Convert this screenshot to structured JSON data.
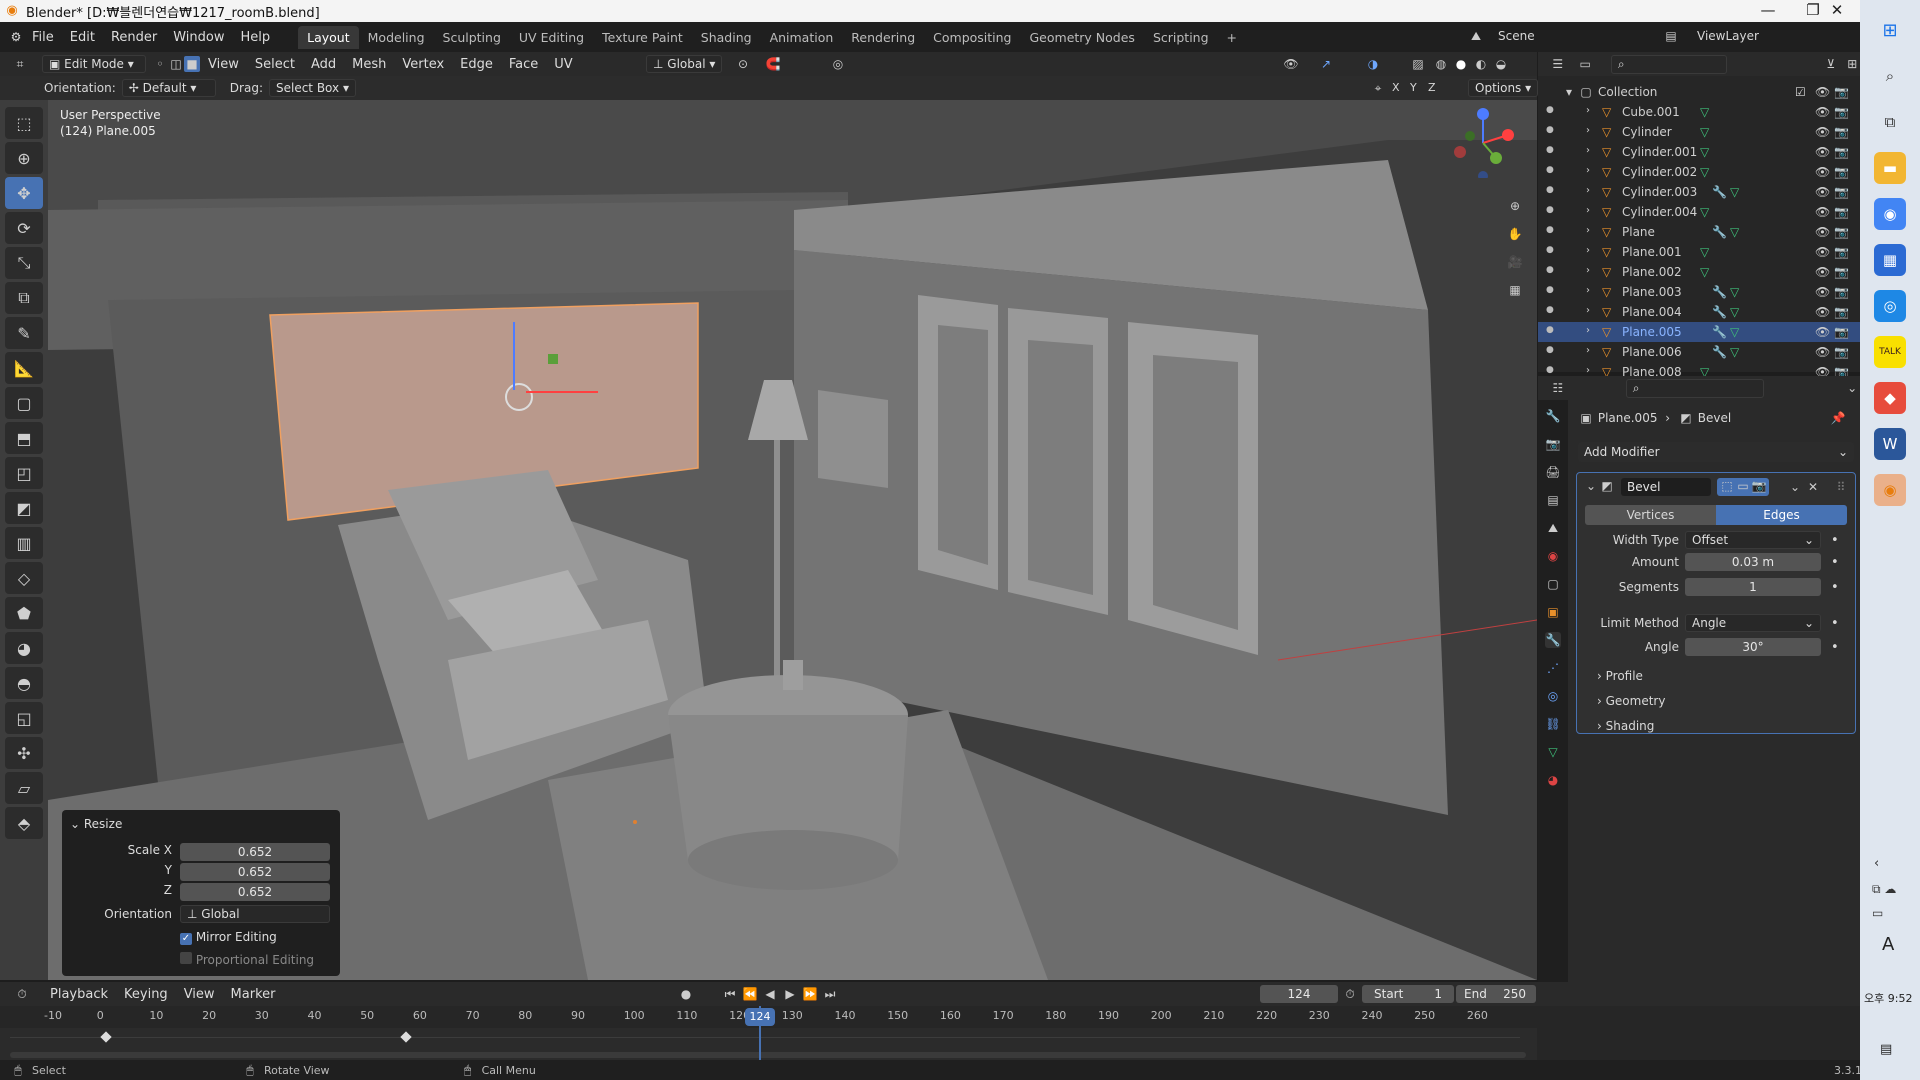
{
  "window": {
    "title": "Blender* [D:₩블렌더연습₩1217_roomB.blend]"
  },
  "menu": {
    "file": "File",
    "edit": "Edit",
    "render": "Render",
    "window": "Window",
    "help": "Help"
  },
  "workspaces": [
    "Layout",
    "Modeling",
    "Sculpting",
    "UV Editing",
    "Texture Paint",
    "Shading",
    "Animation",
    "Rendering",
    "Compositing",
    "Geometry Nodes",
    "Scripting"
  ],
  "scene": {
    "label": "Scene",
    "view_layer": "ViewLayer"
  },
  "header": {
    "mode": "Edit Mode",
    "menus": [
      "View",
      "Select",
      "Add",
      "Mesh",
      "Vertex",
      "Edge",
      "Face",
      "UV"
    ],
    "transform": "Global",
    "orientation_label": "Orientation:",
    "orientation_value": "Default",
    "drag_label": "Drag:",
    "drag_value": "Select Box",
    "axes": [
      "X",
      "Y",
      "Z"
    ],
    "options": "Options"
  },
  "viewport": {
    "perspective": "User Perspective",
    "object": "(124) Plane.005"
  },
  "operator": {
    "title": "Resize",
    "scale_x_label": "Scale X",
    "scale_x": "0.652",
    "y_label": "Y",
    "y": "0.652",
    "z_label": "Z",
    "z": "0.652",
    "orientation_label": "Orientation",
    "orientation": "Global",
    "mirror": "Mirror Editing",
    "mirror_checked": true,
    "proportional": "Proportional Editing",
    "proportional_checked": false
  },
  "outliner": {
    "collection": "Collection",
    "items": [
      {
        "name": "Cube.001",
        "mod": false
      },
      {
        "name": "Cylinder",
        "mod": false
      },
      {
        "name": "Cylinder.001",
        "mod": false
      },
      {
        "name": "Cylinder.002",
        "mod": false
      },
      {
        "name": "Cylinder.003",
        "mod": true
      },
      {
        "name": "Cylinder.004",
        "mod": false
      },
      {
        "name": "Plane",
        "mod": true
      },
      {
        "name": "Plane.001",
        "mod": false
      },
      {
        "name": "Plane.002",
        "mod": false
      },
      {
        "name": "Plane.003",
        "mod": true
      },
      {
        "name": "Plane.004",
        "mod": true
      },
      {
        "name": "Plane.005",
        "mod": true,
        "selected": true
      },
      {
        "name": "Plane.006",
        "mod": true
      },
      {
        "name": "Plane.008",
        "mod": false
      }
    ]
  },
  "properties": {
    "breadcrumb_object": "Plane.005",
    "breadcrumb_modifier": "Bevel",
    "add_modifier": "Add Modifier",
    "modifier_name": "Bevel",
    "tabs": [
      "Vertices",
      "Edges"
    ],
    "active_tab": "Edges",
    "width_type_label": "Width Type",
    "width_type": "Offset",
    "amount_label": "Amount",
    "amount": "0.03 m",
    "segments_label": "Segments",
    "segments": "1",
    "limit_method_label": "Limit Method",
    "limit_method": "Angle",
    "angle_label": "Angle",
    "angle": "30°",
    "subpanels": [
      "Profile",
      "Geometry",
      "Shading"
    ]
  },
  "timeline": {
    "menus": [
      "Playback",
      "Keying",
      "View",
      "Marker"
    ],
    "current_frame": "124",
    "start_label": "Start",
    "start": "1",
    "end_label": "End",
    "end": "250",
    "ruler": [
      "-10",
      "0",
      "10",
      "20",
      "30",
      "40",
      "50",
      "60",
      "70",
      "80",
      "90",
      "100",
      "110",
      "120",
      "130",
      "140",
      "150",
      "160",
      "170",
      "180",
      "190",
      "200",
      "210",
      "220",
      "230",
      "240",
      "250",
      "260"
    ]
  },
  "status": {
    "select": "Select",
    "rotate": "Rotate View",
    "menu": "Call Menu",
    "version": "3.3.1"
  },
  "taskbar": {
    "time": "오후 9:52",
    "ime": "A"
  },
  "colors": {
    "accent": "#4772b3",
    "selected_row": "#334d80",
    "plane_highlight": "#b9998c"
  }
}
